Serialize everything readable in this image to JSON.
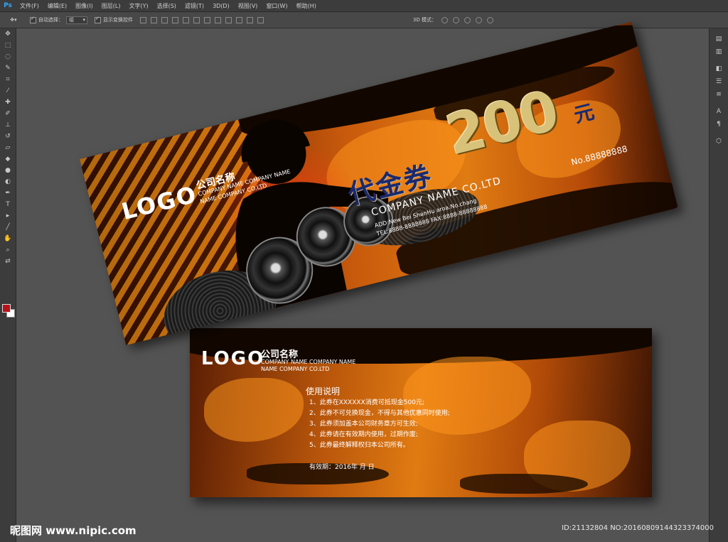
{
  "app": {
    "logo": "Ps",
    "menu": [
      "文件(F)",
      "编辑(E)",
      "图像(I)",
      "图层(L)",
      "文字(Y)",
      "选择(S)",
      "滤镜(T)",
      "3D(D)",
      "视图(V)",
      "窗口(W)",
      "帮助(H)"
    ]
  },
  "options": {
    "auto_select_label": "自动选择：",
    "auto_select_value": "组",
    "show_transform_label": "显示变换控件",
    "mode3d_label": "3D 模式："
  },
  "front_ticket": {
    "logo": "LOGO",
    "company_cn": "公司名称",
    "company_en_line1": "COMPANY NAME COMPANY NAME",
    "company_en_line2": "NAME COMPANY CO.LTD",
    "title": "代金券",
    "amount": "200",
    "unit": "元",
    "number": "No.88888888",
    "company_name": "COMPANY NAME CO.LTD",
    "address": "ADD:New Bei ShanHu aroa.No.chang",
    "contact": "TEL:8888-8888888   FAX:8888-88888888"
  },
  "back_ticket": {
    "logo": "LOGO",
    "company_cn": "公司名称",
    "company_en_line1": "COMPANY NAME COMPANY NAME",
    "company_en_line2": "NAME COMPANY CO.LTD",
    "usage_title": "使用说明",
    "rules": [
      "1、此券在XXXXXX消费可抵现金500元;",
      "2、此券不可兑换现金，不得与其他优惠同时使用;",
      "3、此券须加盖本公司财务章方可生效;",
      "4、此券请在有效期内使用，过期作废;",
      "5、此券最终解释权归本公司所有。"
    ],
    "validity": "有效期：2016年    月    日"
  },
  "watermark": {
    "site": "昵图网 www.nipic.com",
    "image_id": "ID:21132804 NO:20160809144323374000"
  }
}
